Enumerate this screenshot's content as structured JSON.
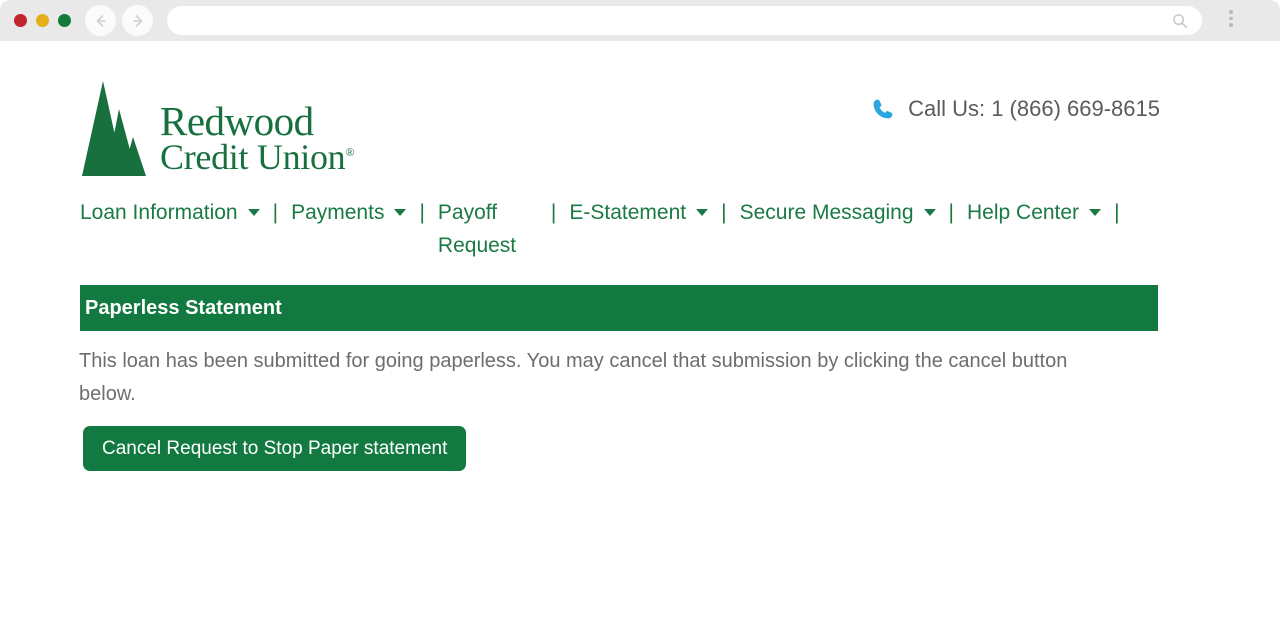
{
  "browser": {
    "traffic_lights": [
      {
        "name": "close",
        "color": "#c0252c"
      },
      {
        "name": "minimize",
        "color": "#e3b019"
      },
      {
        "name": "maximize",
        "color": "#127a3a"
      }
    ],
    "back_icon": "back-arrow-icon",
    "forward_icon": "forward-arrow-icon",
    "address_value": "",
    "address_placeholder": "",
    "search_icon": "search-icon",
    "menu_icon": "kebab-menu-icon"
  },
  "header": {
    "logo": {
      "mark": "redwood-tree-icon",
      "line1": "Redwood",
      "line2": "Credit Union",
      "trademark": "®",
      "color": "#17703d"
    },
    "contact": {
      "icon": "phone-icon",
      "icon_color": "#2ba6de",
      "text": "Call Us: 1 (866) 669-8615"
    }
  },
  "nav": {
    "separator": "|",
    "items": [
      {
        "label": "Loan Information",
        "has_caret": true,
        "wide": true
      },
      {
        "label": "Payments",
        "has_caret": true,
        "wide": true
      },
      {
        "label": "Payoff Request",
        "has_caret": false,
        "wide": false
      },
      {
        "label": "E-Statement",
        "has_caret": true,
        "wide": true
      },
      {
        "label": "Secure Messaging",
        "has_caret": true,
        "wide": true
      },
      {
        "label": "Help Center",
        "has_caret": true,
        "wide": true
      }
    ]
  },
  "content": {
    "section_title": "Paperless Statement",
    "section_color": "#127a40",
    "body_text": "This loan has been submitted for going paperless. You may cancel that submission by clicking the cancel button below.",
    "cancel_button_label": "Cancel Request to Stop Paper statement"
  }
}
